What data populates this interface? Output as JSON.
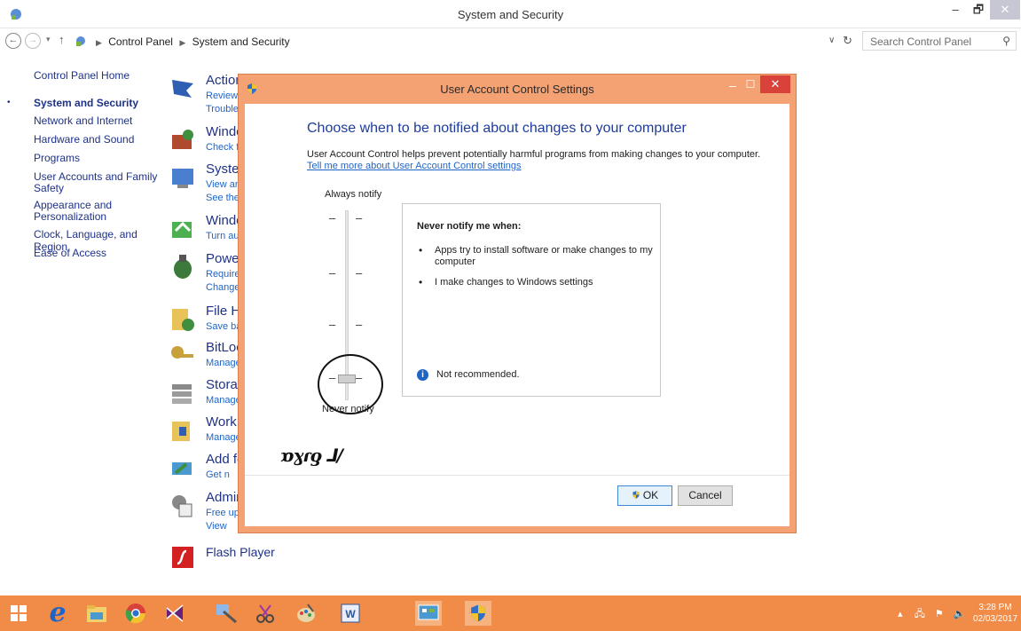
{
  "window": {
    "title": "System and Security",
    "min_label": "–",
    "max_label": "🗗",
    "close_label": "✕"
  },
  "address": {
    "crumbs": [
      "Control Panel",
      "System and Security"
    ],
    "search_placeholder": "Search Control Panel"
  },
  "leftnav": {
    "items": [
      "Control Panel Home",
      "System and Security",
      "Network and Internet",
      "Hardware and Sound",
      "Programs",
      "User Accounts and Family",
      "Safety",
      "Appearance and",
      "Personalization",
      "Clock, Language, and Region",
      "Ease of Access"
    ]
  },
  "content": {
    "items": [
      {
        "title": "Action",
        "sub1": "Review",
        "sub2": "Trouble"
      },
      {
        "title": "Windo",
        "sub1": "Check f",
        "sub2": ""
      },
      {
        "title": "Syster",
        "sub1": "View an",
        "sub2": "See the"
      },
      {
        "title": "Windo",
        "sub1": "Turn au",
        "sub2": ""
      },
      {
        "title": "Power",
        "sub1": "Require",
        "sub2": "Change"
      },
      {
        "title": "File Hi",
        "sub1": "Save ba",
        "sub2": ""
      },
      {
        "title": "BitLoc",
        "sub1": "Manage",
        "sub2": ""
      },
      {
        "title": "Storag",
        "sub1": "Manage",
        "sub2": ""
      },
      {
        "title": "Work",
        "sub1": "Manage",
        "sub2": ""
      },
      {
        "title": "Add fe",
        "sub1": "Get n",
        "sub2": ""
      },
      {
        "title": "Admir",
        "sub1": "Free up",
        "sub2": "View"
      },
      {
        "title": "Flash Player",
        "sub1": "",
        "sub2": ""
      }
    ]
  },
  "dialog": {
    "title": "User Account Control Settings",
    "heading": "Choose when to be notified about changes to your computer",
    "description": "User Account Control helps prevent potentially harmful programs from making changes to your computer.",
    "link": "Tell me more about User Account Control settings",
    "slider_top_label": "Always notify",
    "slider_bottom_label": "Never notify",
    "slider_level": 0,
    "slider_levels": 4,
    "box_heading": "Never notify me when:",
    "box_items": [
      "Apps try to install software or make changes to my computer",
      "I make changes to Windows settings"
    ],
    "box_note": "Not recommended.",
    "ok_label": "OK",
    "cancel_label": "Cancel",
    "handwriting": "ɒɣɾƍ ⅃/"
  },
  "taskbar": {
    "clock_time": "3:28 PM",
    "clock_date": "02/03/2017"
  },
  "colors": {
    "accent": "#f08c48",
    "dialog_frame": "#f4a274",
    "link": "#1e64c8",
    "heading": "#1e3c9c"
  }
}
